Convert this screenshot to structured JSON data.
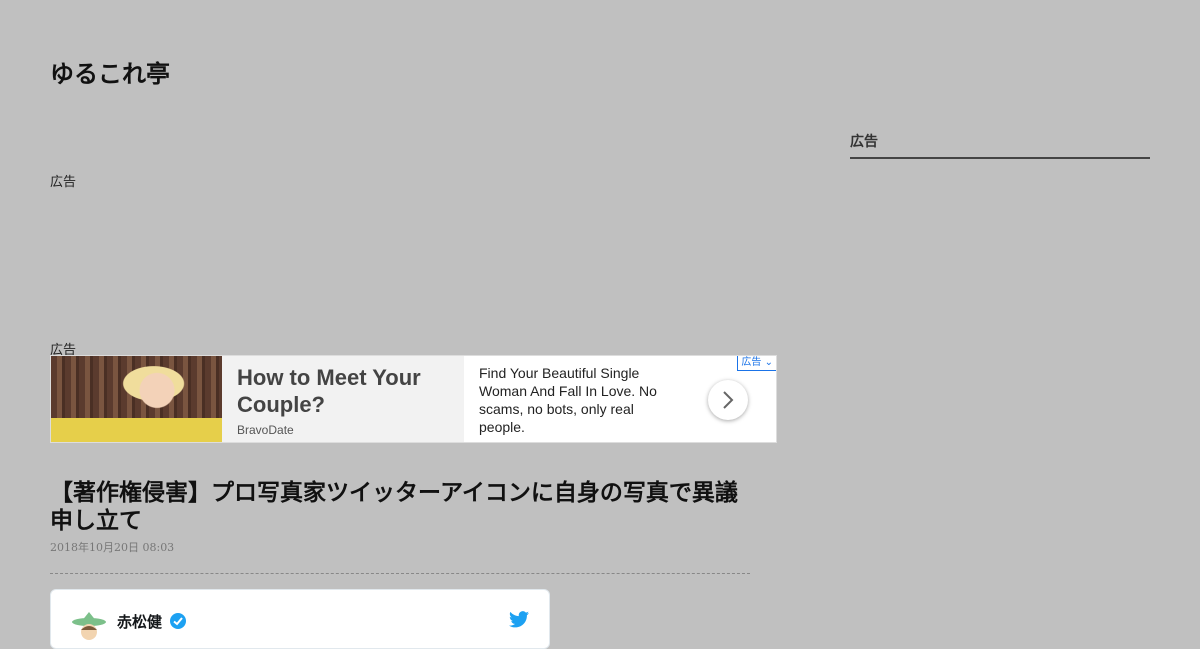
{
  "header": {
    "site_title": "ゆるこれ亭"
  },
  "ads": {
    "label_top": "広告",
    "label_banner": "広告",
    "banner": {
      "headline": "How to Meet Your Couple?",
      "advertiser": "BravoDate",
      "description": "Find Your Beautiful Single Woman And Fall In Love. No scams, no bots, only real people.",
      "choice_label": "広告",
      "arrow_icon": "chevron-right-icon"
    }
  },
  "sidebar": {
    "heading": "広告"
  },
  "post": {
    "title": "【著作権侵害】プロ写真家ツイッターアイコンに自身の写真で異議申し立て",
    "date": "2018年10月20日 08:03"
  },
  "tweet": {
    "author_name": "赤松健",
    "verified_icon": "verified-badge-icon",
    "brand_icon": "twitter-bird-icon",
    "brand_color": "#1da1f2"
  },
  "colors": {
    "page_background": "#c0c0c0",
    "ad_choice": "#1a73e8",
    "verified": "#1da1f2"
  }
}
